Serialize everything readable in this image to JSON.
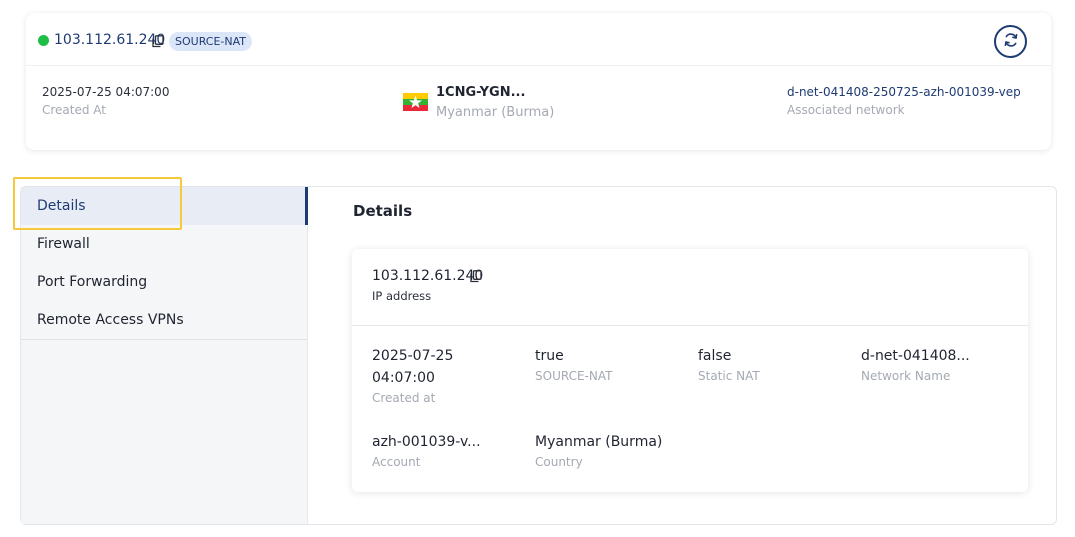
{
  "summary": {
    "ip": "103.112.61.240",
    "badge": "SOURCE-NAT",
    "created_value": "2025-07-25 04:07:00",
    "created_label": "Created At",
    "location_name": "1CNG-YGN...",
    "location_country": "Myanmar (Burma)",
    "network_value": "d-net-041408-250725-azh-001039-vep",
    "network_label": "Associated network",
    "status_color": "#1fbe46"
  },
  "nav": {
    "items": [
      {
        "label": "Details"
      },
      {
        "label": "Firewall"
      },
      {
        "label": "Port Forwarding"
      },
      {
        "label": "Remote Access VPNs"
      }
    ]
  },
  "details": {
    "title": "Details",
    "ip_value": "103.112.61.240",
    "ip_label": "IP address",
    "created_value_line1": "2025-07-25",
    "created_value_line2": "04:07:00",
    "created_label": "Created at",
    "source_nat_value": "true",
    "source_nat_label": "SOURCE-NAT",
    "static_nat_value": "false",
    "static_nat_label": "Static NAT",
    "network_name_value": "d-net-041408...",
    "network_name_label": "Network Name",
    "account_value": "azh-001039-v...",
    "account_label": "Account",
    "country_value": "Myanmar (Burma)",
    "country_label": "Country"
  },
  "colors": {
    "accent": "#1f3b73",
    "highlight": "#f5c93a"
  }
}
